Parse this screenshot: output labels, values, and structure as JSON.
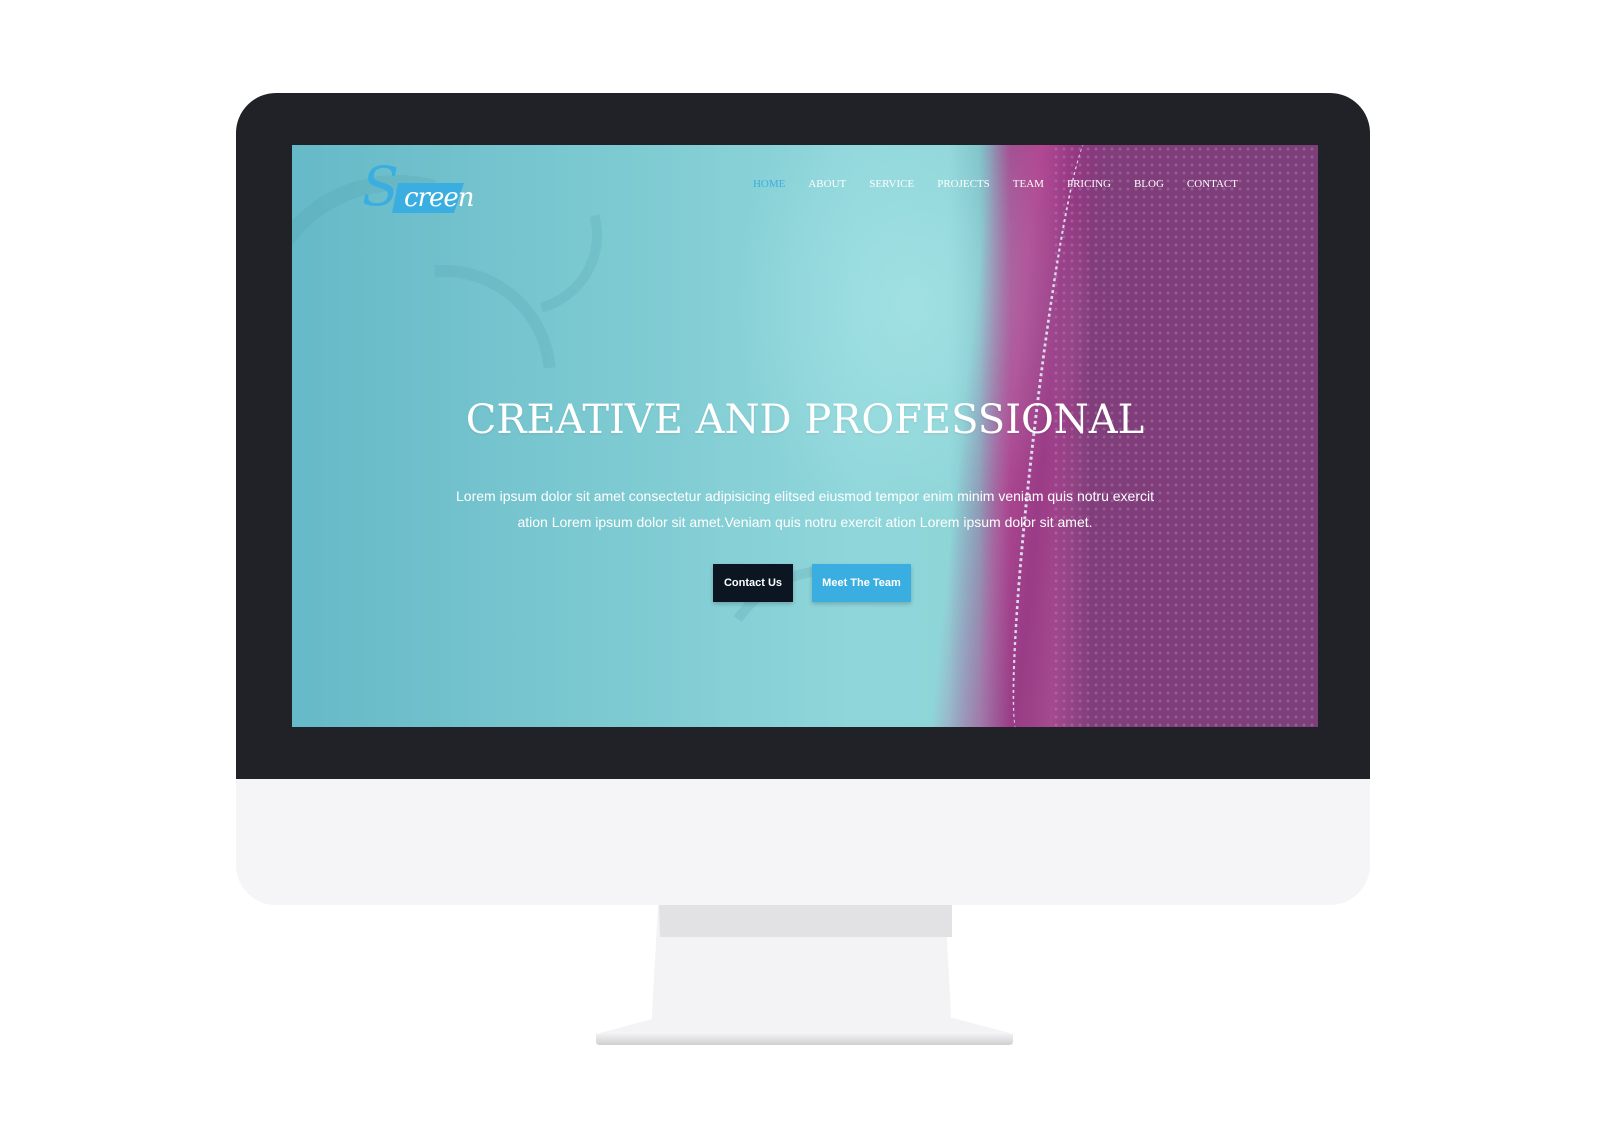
{
  "site": {
    "logo": {
      "initial": "S",
      "text": "creen"
    },
    "nav": {
      "items": [
        {
          "label": "HOME",
          "active": true
        },
        {
          "label": "ABOUT",
          "active": false
        },
        {
          "label": "SERVICE",
          "active": false
        },
        {
          "label": "PROJECTS",
          "active": false
        },
        {
          "label": "TEAM",
          "active": false
        },
        {
          "label": "PRICING",
          "active": false
        },
        {
          "label": "BLOG",
          "active": false
        },
        {
          "label": "CONTACT",
          "active": false
        }
      ]
    },
    "hero": {
      "title": "CREATIVE AND PROFESSIONAL",
      "text": "Lorem ipsum dolor sit amet consectetur adipisicing elitsed eiusmod tempor enim minim veniam quis notru exercit ation Lorem ipsum dolor sit amet.Veniam quis notru exercit ation Lorem ipsum dolor sit amet.",
      "buttons": {
        "contact": "Contact Us",
        "team": "Meet The Team"
      }
    }
  },
  "colors": {
    "accent": "#3aaee0",
    "dark_button": "#0c1522",
    "bezel": "#212227"
  }
}
